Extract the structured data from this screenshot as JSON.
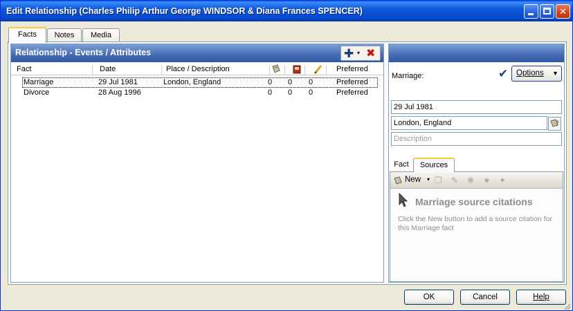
{
  "window": {
    "title": "Edit Relationship (Charles Philip Arthur George WINDSOR & Diana Frances SPENCER)"
  },
  "tabs": [
    {
      "label": "Facts",
      "active": true
    },
    {
      "label": "Notes",
      "active": false
    },
    {
      "label": "Media",
      "active": false
    }
  ],
  "events_panel": {
    "title": "Relationship - Events / Attributes",
    "columns": {
      "fact": "Fact",
      "date": "Date",
      "place": "Place / Description",
      "preferred": "Preferred"
    },
    "rows": [
      {
        "fact": "Marriage",
        "date": "29 Jul 1981",
        "place": "London, England",
        "c1": "0",
        "c2": "0",
        "c3": "0",
        "preferred": "Preferred",
        "selected": true
      },
      {
        "fact": "Divorce",
        "date": "28 Aug 1996",
        "place": "",
        "c1": "0",
        "c2": "0",
        "c3": "0",
        "preferred": "Preferred",
        "selected": false
      }
    ]
  },
  "detail_panel": {
    "fact_label": "Marriage:",
    "options_label": "Options",
    "date_value": "29 Jul 1981",
    "place_value": "London, England",
    "description_placeholder": "Description",
    "subtabs": [
      {
        "label": "Fact",
        "active": false
      },
      {
        "label": "Sources",
        "active": true
      }
    ],
    "sources_toolbar": {
      "new_label": "New"
    },
    "sources_title": "Marriage source citations",
    "sources_hint": "Click the New button to add a source citation for this Marriage fact"
  },
  "buttons": {
    "ok": "OK",
    "cancel": "Cancel",
    "help": "Help"
  }
}
